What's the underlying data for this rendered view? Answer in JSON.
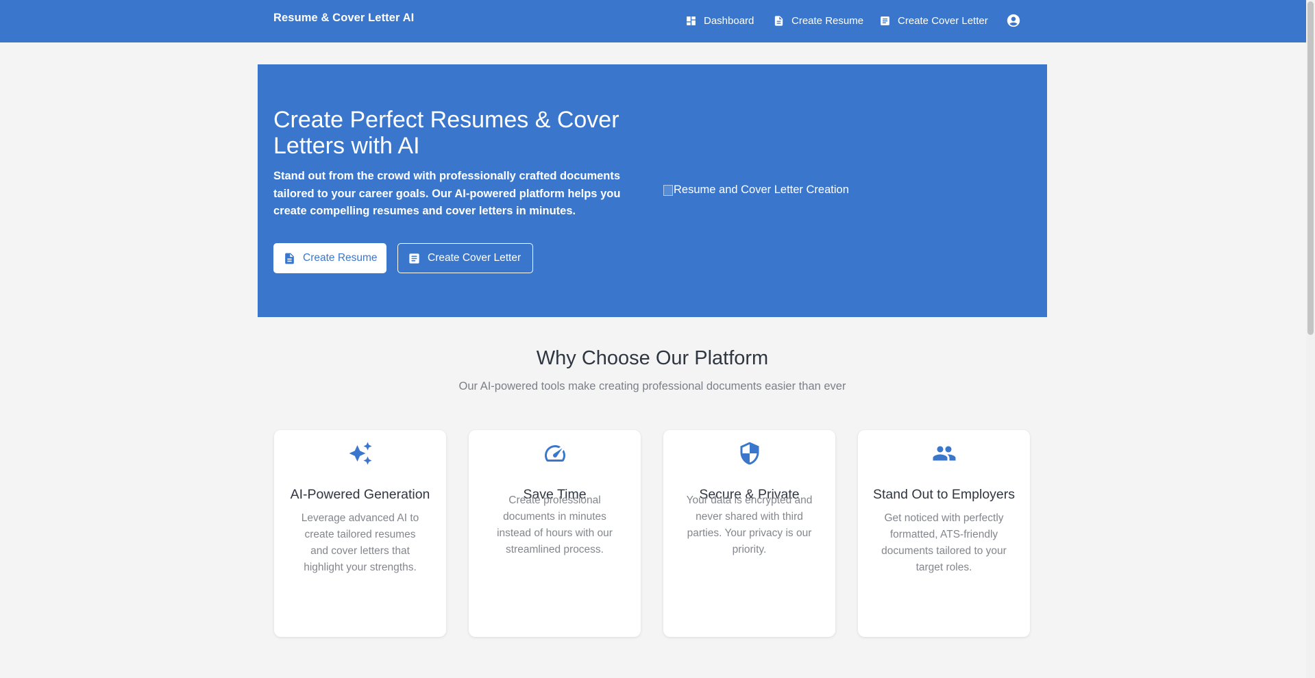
{
  "header": {
    "brand": "Resume & Cover Letter AI",
    "nav": [
      {
        "label": "Dashboard",
        "icon": "dashboard-icon"
      },
      {
        "label": "Create Resume",
        "icon": "document-icon"
      },
      {
        "label": "Create Cover Letter",
        "icon": "article-icon"
      }
    ],
    "account_icon": "account-circle-icon"
  },
  "hero": {
    "title": "Create Perfect Resumes & Cover Letters with AI",
    "subtitle": "Stand out from the crowd with professionally crafted documents tailored to your career goals. Our AI-powered platform helps you create compelling resumes and cover letters in minutes.",
    "primary_button": {
      "label": "Create Resume",
      "icon": "document-icon"
    },
    "secondary_button": {
      "label": "Create Cover Letter",
      "icon": "article-icon"
    },
    "image_alt": "Resume and Cover Letter Creation"
  },
  "features": {
    "title": "Why Choose Our Platform",
    "subtitle": "Our AI-powered tools make creating professional documents easier than ever",
    "cards": [
      {
        "icon": "sparkle-icon",
        "title": "AI-Powered Generation",
        "body": "Leverage advanced AI to create tailored resumes and cover letters that highlight your strengths."
      },
      {
        "icon": "speedometer-icon",
        "title": "Save Time",
        "body": "Create professional documents in minutes instead of hours with our streamlined process."
      },
      {
        "icon": "shield-icon",
        "title": "Secure & Private",
        "body": "Your data is encrypted and never shared with third parties. Your privacy is our priority."
      },
      {
        "icon": "people-icon",
        "title": "Stand Out to Employers",
        "body": "Get noticed with perfectly formatted, ATS-friendly documents tailored to your target roles."
      }
    ]
  },
  "colors": {
    "primary": "#3a77cc",
    "background": "#f4f4f5",
    "text": "#2f3640",
    "muted": "#7b7f86"
  }
}
